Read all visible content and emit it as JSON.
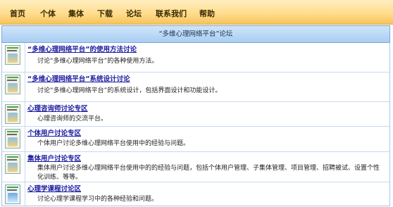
{
  "nav": {
    "items": [
      "首页",
      "个体",
      "集体",
      "下载",
      "论坛",
      "联系我们",
      "帮助"
    ]
  },
  "header": {
    "title": "“多维心理网络平台”论坛"
  },
  "forums": [
    {
      "title": "“多维心理网络平台”的使用方法讨论",
      "desc": "讨论“多维心理网络平台”的各种使用方法。"
    },
    {
      "title": "“多维心理网络平台”系统设计讨论",
      "desc": "讨论“多维心理网络平台”的系统设计，包括界面设计和功能设计。"
    },
    {
      "title": "心理咨询师讨论专区",
      "desc": "心理咨询师的交流平台。"
    },
    {
      "title": "个体用户讨论专区",
      "desc": "个体用户讨论多维心理网络平台使用中的经验与问题。"
    },
    {
      "title": "集体用户讨论专区",
      "desc": "集体用户讨论多维心理网络平台使用中的的经验与问题，包括个体用户管理、子集体管理、项目管理、招聘被试、设置个性化训练、等等。"
    },
    {
      "title": "心理学课程讨论区",
      "desc": "讨论心理学课程学习中的各种经验和问题。"
    }
  ],
  "colors": {
    "nav_bg": "#ffdb8a",
    "header_bg": "#a9cdf2",
    "link": "#1a1aa0"
  }
}
